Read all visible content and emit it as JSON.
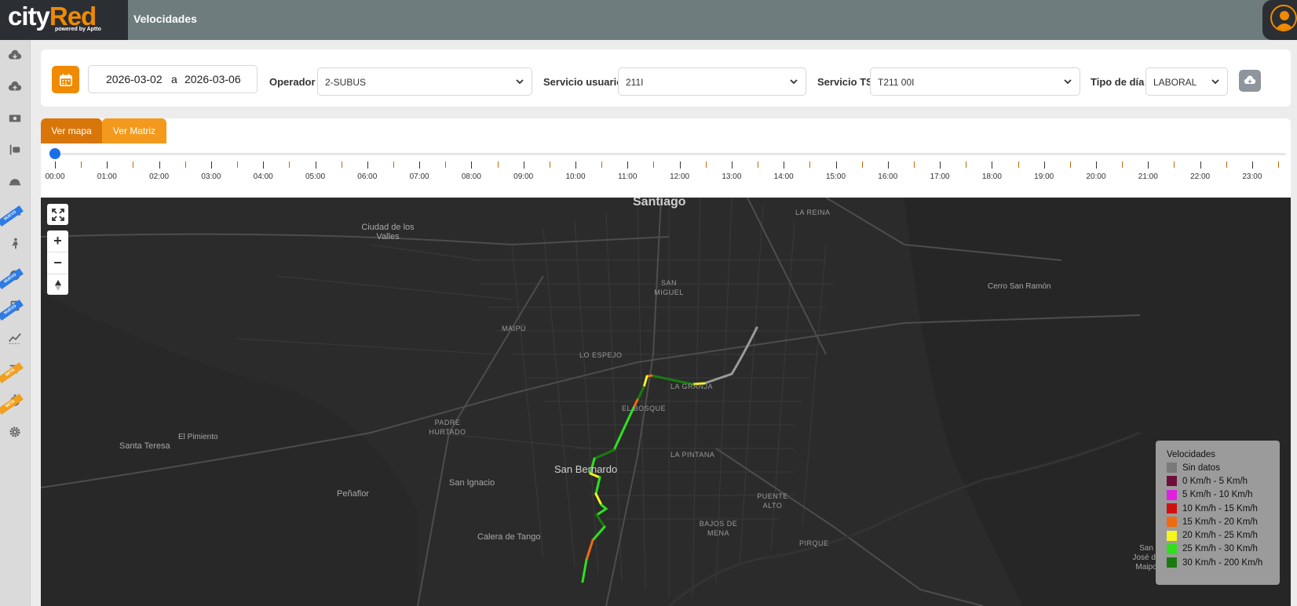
{
  "app": {
    "logo_city": "city",
    "logo_red": "Red",
    "logo_sub": "powered by Aptto",
    "title": "Velocidades"
  },
  "filters": {
    "date_from": "2026-03-02",
    "date_sep": "a",
    "date_to": "2026-03-06",
    "operador_label": "Operador",
    "operador_value": "2-SUBUS",
    "servicio_usuario_label": "Servicio usuario",
    "servicio_usuario_value": "211I",
    "servicio_ts_label": "Servicio TS",
    "servicio_ts_value": "T211 00I",
    "tipo_dia_label": "Tipo de día",
    "tipo_dia_value": "LABORAL"
  },
  "tabs": {
    "map": "Ver mapa",
    "matrix": "Ver Matriz"
  },
  "timeline": {
    "hours": [
      "00:00",
      "01:00",
      "02:00",
      "03:00",
      "04:00",
      "05:00",
      "06:00",
      "07:00",
      "08:00",
      "09:00",
      "10:00",
      "11:00",
      "12:00",
      "13:00",
      "14:00",
      "15:00",
      "16:00",
      "17:00",
      "18:00",
      "19:00",
      "20:00",
      "21:00",
      "22:00",
      "23:00"
    ],
    "selected": "00:00"
  },
  "sidebar": {
    "ribbons": {
      "nuevo": "NUEVO",
      "beta": "BETA"
    },
    "items": [
      {
        "icon": "cloud-download-icon"
      },
      {
        "icon": "cloud-upload-icon"
      },
      {
        "icon": "money-icon"
      },
      {
        "icon": "bus-stop-icon"
      },
      {
        "icon": "dome-icon"
      },
      {
        "icon": "speedometer-icon",
        "badge": "NUEVO"
      },
      {
        "icon": "person-icon"
      },
      {
        "icon": "pie-chart-icon",
        "badge": "NUEVO"
      },
      {
        "icon": "bus-icon",
        "badge": "NUEVO"
      },
      {
        "icon": "trend-icon"
      },
      {
        "icon": "list-icon",
        "badge": "BETA"
      },
      {
        "icon": "stopwatch-icon",
        "badge": "BETA"
      },
      {
        "icon": "gear-icon"
      }
    ]
  },
  "map": {
    "places": {
      "santiago": "Santiago",
      "la_reina": "LA REINA",
      "ciudad_valles": "Ciudad de los Valles",
      "cerro_san_ramon": "Cerro San Ramón",
      "san_miguel": "SAN MIGUEL",
      "maipu": "MAIPÚ",
      "lo_espejo": "LO ESPEJO",
      "la_granja": "LA GRANJA",
      "el_bosque": "EL BOSQUE",
      "padre_hurtado": "PADRE HURTADO",
      "el_pimiento": "El Pimiento",
      "santa_teresa": "Santa Teresa",
      "la_pintana": "LA PINTANA",
      "san_bernardo": "San Bernardo",
      "san_ignacio": "San Ignacio",
      "penaflor": "Peñaflor",
      "puente_alto": "PUENTE ALTO",
      "bajos_de_mena": "BAJOS DE MENA",
      "calera_de_tango": "Calera de Tango",
      "pirque": "PIRQUE",
      "san_jose_maipo": "San José de Maipo"
    },
    "controls": {
      "zoom_in": "+",
      "zoom_out": "−"
    }
  },
  "legend": {
    "title": "Velocidades",
    "items": [
      {
        "label": "Sin datos",
        "color": "#7a7a7a"
      },
      {
        "label": "0 Km/h - 5 Km/h",
        "color": "#6b0f3a"
      },
      {
        "label": "5 Km/h - 10 Km/h",
        "color": "#e020e0"
      },
      {
        "label": "10 Km/h - 15 Km/h",
        "color": "#d01010"
      },
      {
        "label": "15 Km/h - 20 Km/h",
        "color": "#f06a10"
      },
      {
        "label": "20 Km/h - 25 Km/h",
        "color": "#f5f520"
      },
      {
        "label": "25 Km/h - 30 Km/h",
        "color": "#30e020"
      },
      {
        "label": "30 Km/h - 200 Km/h",
        "color": "#1a7a10"
      }
    ]
  },
  "colors": {
    "accent": "#f08a00",
    "topbar": "#6f7c7e",
    "map_bg": "#2b2b2b"
  }
}
